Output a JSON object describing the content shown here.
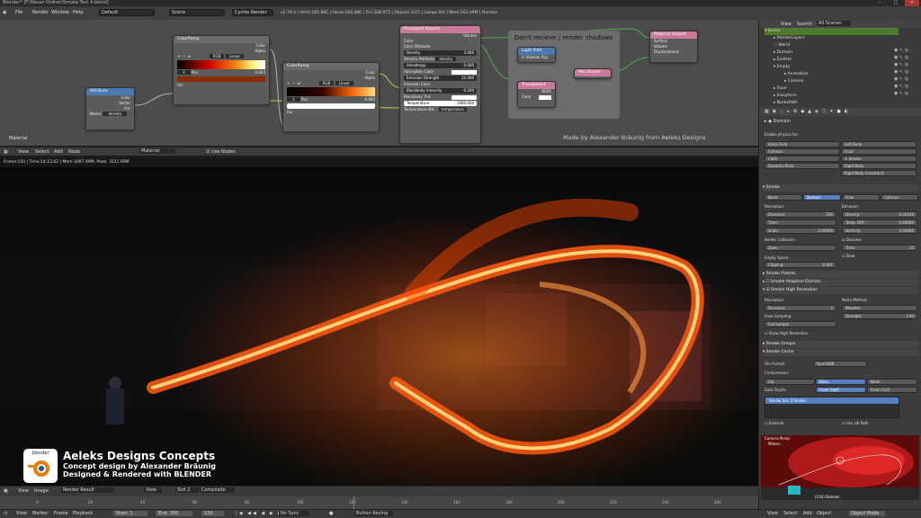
{
  "window": {
    "title": "Blender* [F:\\Neuer Ordner\\Smoke Test 4.blend]"
  },
  "menu": [
    "File",
    "Render",
    "Window",
    "Help"
  ],
  "header": {
    "layout": "Default",
    "scene": "Scene",
    "engine": "Cycles Render",
    "stats": "v2.79.4 | Verts:165,885 | Faces:164,486 | Tris:328,972 | Objects:1/15 | Lamps:0/2 | Mem:263.09M | Domain"
  },
  "node_editor": {
    "nodes": [
      {
        "title": "Attribute",
        "color": "#4a78b0",
        "rows": [
          "Color",
          "Vector",
          "Fac",
          "Name:",
          "density"
        ]
      },
      {
        "title": "ColorRamp",
        "color": "#6a6a6a",
        "rows": [
          "Color",
          "Alpha",
          "RGB",
          "Linear",
          "3",
          "Pos:",
          "0.824",
          "Fac"
        ]
      },
      {
        "title": "ColorRamp",
        "color": "#6a6a6a",
        "rows": [
          "Color",
          "Alpha",
          "RGB",
          "Linear",
          "3",
          "Pos:",
          "0.892",
          "Fac"
        ]
      },
      {
        "title": "Principled Volume",
        "color": "#c97a9a",
        "rows": [
          "Volume",
          "Color",
          "Color Attribute",
          "Density",
          "3.000",
          "Density Attribute",
          "density",
          "Anisotropy",
          "0.000",
          "Absorption Color",
          "Emission Strength",
          "15.000",
          "Emission Color",
          "Blackbody Intensity",
          "0.200",
          "Blackbody Tint",
          "Temperature",
          "1000.000",
          "Temperature Attr...",
          "temperature"
        ]
      },
      {
        "title": "Light Path",
        "color": "#4a78b0",
        "rows": [
          "Is Shadow Ray"
        ]
      },
      {
        "title": "Transparent",
        "color": "#c97a9a",
        "rows": [
          "BSDF",
          "Color"
        ]
      },
      {
        "title": "Mix Shader",
        "color": "#c97a9a",
        "rows": []
      },
      {
        "title": "Material Output",
        "color": "#c97a9a",
        "rows": [
          "Surface",
          "Volume",
          "Displacement"
        ]
      }
    ],
    "frame_label": "Don't recieve / render shadows",
    "material_label": "Material",
    "credit": "Made by Alexander Bräunig from Aeleks Designs",
    "footer": [
      "View",
      "Select",
      "Add",
      "Node",
      "Material",
      "Use Nodes"
    ]
  },
  "viewport": {
    "info": "Frame:150 | Time:14:23.62 | Mem:3097.99M, Peak: 3121.69M"
  },
  "overlay": {
    "logo_text": "blender",
    "title": "Aeleks Designs Concepts",
    "line1": "Concept design by Alexander Bräunig",
    "line2": "Designed & Rendered with BLENDER"
  },
  "image_editor_bar": [
    "View",
    "Image",
    "Render Result",
    "View",
    "Slot 2",
    "Composite"
  ],
  "timeline": {
    "menu": [
      "View",
      "Marker",
      "Frame",
      "Playback"
    ],
    "start_label": "Start:",
    "start": "1",
    "end_label": "End:",
    "end": "300",
    "current": "150",
    "sync": "No Sync",
    "keying": "Button Keying",
    "ticks": [
      "0",
      "20",
      "40",
      "60",
      "80",
      "100",
      "120",
      "140",
      "160",
      "180",
      "200",
      "220",
      "240",
      "260"
    ]
  },
  "outliner": {
    "header": [
      "View",
      "Search",
      "All Scenes"
    ],
    "items": [
      "Scene",
      "RenderLayers",
      "World",
      "Domain",
      "Emitter",
      "Empty",
      "Animation",
      "Camera",
      "Floor",
      "Icosphere",
      "NurbsPath"
    ]
  },
  "properties": {
    "object": "Domain",
    "enable_label": "Enable physics for:",
    "physics_buttons": [
      "Force Field",
      "Soft Body",
      "Collision",
      "Fluid",
      "Cloth",
      "Smoke",
      "Dynamic Paint",
      "Rigid Body",
      "Rigid Body Constraint"
    ],
    "smoke_panel": "Smoke",
    "smoke_tabs": [
      "None",
      "Domain",
      "Flow",
      "Collision"
    ],
    "resolution": "Resolution:",
    "behavior": "Behavior:",
    "divisions_label": "Divisions:",
    "divisions": "256",
    "density_label": "Density:",
    "density": "0.00100",
    "time_label": "Time:",
    "time": "",
    "temp_label": "Temp. Diff.:",
    "temp": "0.40000",
    "scale_label": "Scale:",
    "scale": "1.00000",
    "vorticity_label": "Vorticity:",
    "vorticity": "1.00000",
    "border": "Border Collisions:",
    "open": "Open",
    "dissolve": "Dissolve",
    "time2": "Time:",
    "time2_val": "25",
    "slow": "Slow",
    "empty_space": "Empty Space:",
    "clipping_label": "Clipping:",
    "clipping": "0.001",
    "sections": [
      "Smoke Flames",
      "Smoke Adaptive Domain",
      "Smoke High Resolution"
    ],
    "hires": {
      "resolution": "Resolution:",
      "noise": "Noise Method:",
      "divisions_label": "Divisions:",
      "divisions": "2",
      "wavelet": "Wavelet",
      "flow_sampling": "Flow Sampling:",
      "strength_label": "Strength:",
      "strength": "1.00",
      "full_sample": "Full Sample",
      "show": "Show High Resolution"
    },
    "groups": "Smoke Groups",
    "cache": "Smoke Cache",
    "file_format_label": "File Format:",
    "file_format": "OpenVDB",
    "compression": "Compression:",
    "comp_opts": [
      "Zip",
      "Blosc",
      "None"
    ],
    "data_depth": "Data Depth:",
    "depth_opts": [
      "Float (Half)",
      "Float (Full)"
    ],
    "cache_item": "Smoke Sim 3 Smoke",
    "external": "External",
    "use_lib_path": "Use Lib Path"
  },
  "camera_view": {
    "label": "Camera Persp",
    "sub": "Meters",
    "domain": "(150) Domain"
  },
  "bottom_right": [
    "View",
    "Select",
    "Add",
    "Object",
    "Object Mode"
  ],
  "colors": {
    "fire": "#ff7a1a",
    "select_blue": "#5680c2",
    "shader_node": "#c97a9a",
    "input_node": "#4a78b0"
  }
}
